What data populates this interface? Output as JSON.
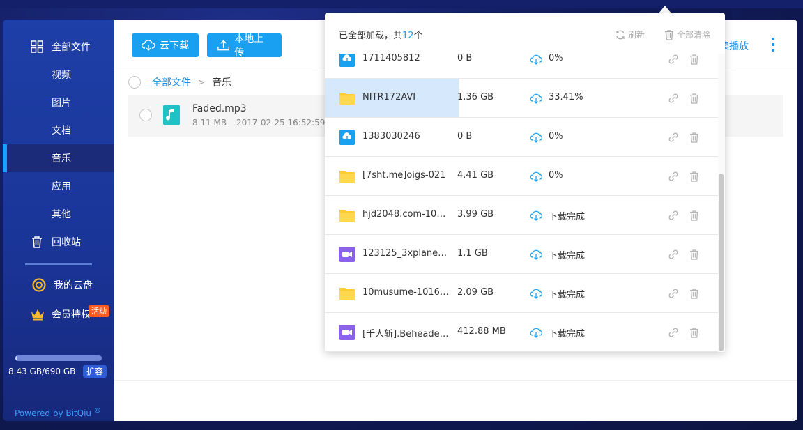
{
  "sidebar": {
    "items": [
      {
        "label": "全部文件",
        "icon": "grid-icon"
      },
      {
        "label": "视频"
      },
      {
        "label": "图片"
      },
      {
        "label": "文档"
      },
      {
        "label": "音乐",
        "active": true
      },
      {
        "label": "应用"
      },
      {
        "label": "其他"
      },
      {
        "label": "回收站",
        "icon": "trash-icon"
      },
      {
        "label": "我的云盘",
        "icon": "cloud-disk-icon"
      },
      {
        "label": "会员特权",
        "icon": "crown-icon"
      }
    ],
    "activity_badge": "活动",
    "storage": {
      "text": "8.43 GB/690 GB",
      "used_fraction": 0.0122,
      "expand_label": "扩容"
    },
    "powered_by": "Powered by BitQiu",
    "powered_mark": "®"
  },
  "toolbar": {
    "cloud_download_label": "云下载",
    "local_upload_label": "本地上传",
    "right_action_label": "续播放"
  },
  "breadcrumb": {
    "root": "全部文件",
    "separator": ">",
    "current": "音乐"
  },
  "files": [
    {
      "name": "Faded.mp3",
      "size": "8.11 MB",
      "date": "2017-02-25 16:52:59"
    }
  ],
  "download_panel": {
    "title_prefix": "已全部加载，共",
    "count": "12",
    "title_suffix": "个",
    "refresh_label": "刷新",
    "clear_label": "全部清除",
    "rows": [
      {
        "name": "1711405812",
        "size": "0 B",
        "status": "0%",
        "icon": "cloud-file-icon",
        "progress": 0
      },
      {
        "name": "NITR172AVI",
        "size": "1.36 GB",
        "status": "33.41%",
        "icon": "folder-icon",
        "progress": 0.3341
      },
      {
        "name": "1383030246",
        "size": "0 B",
        "status": "0%",
        "icon": "cloud-file-icon",
        "progress": 0
      },
      {
        "name": "[7sht.me]oigs-021",
        "size": "4.41 GB",
        "status": "0%",
        "icon": "folder-icon",
        "progress": 0
      },
      {
        "name": "hjd2048.com-102…",
        "size": "3.99 GB",
        "status": "下载完成",
        "icon": "folder-icon",
        "progress": 0
      },
      {
        "name": "123125_3xplanet…",
        "size": "1.1 GB",
        "status": "下载完成",
        "icon": "video-icon",
        "progress": 0
      },
      {
        "name": "10musume-1016…",
        "size": "2.09 GB",
        "status": "下载完成",
        "icon": "folder-icon",
        "progress": 0
      },
      {
        "name": "[千人斩].Beheaded…",
        "size": "412.88 MB",
        "status": "下载完成",
        "icon": "video-icon",
        "progress": 0
      }
    ]
  },
  "colors": {
    "accent": "#1aa0f0",
    "sidebar": "#1e3fa8",
    "folder": "#ffcc33",
    "video": "#8a63e6",
    "badge": "#ff5a1f"
  }
}
